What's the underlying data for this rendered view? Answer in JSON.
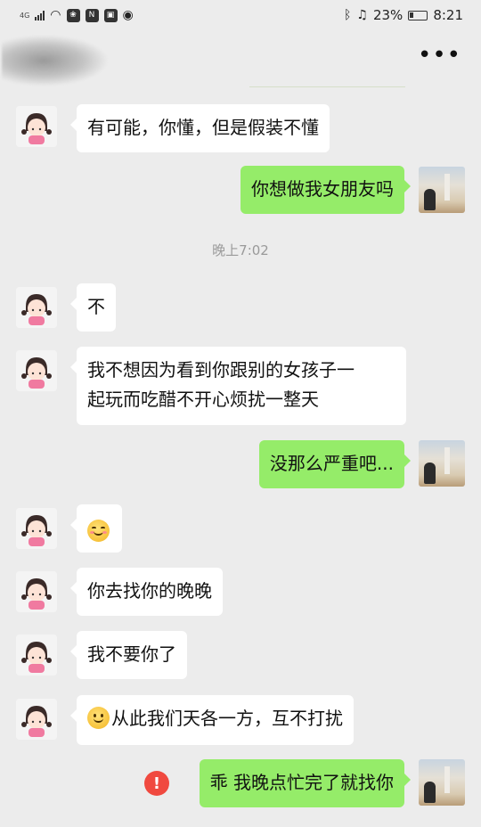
{
  "status_bar": {
    "network": "4G",
    "battery_percent": "23%",
    "time": "8:21"
  },
  "header": {
    "more_button_label": "•••"
  },
  "messages": [
    {
      "side": "left",
      "text": "有可能，你懂，但是假装不懂"
    },
    {
      "side": "right",
      "text": "你想做我女朋友吗"
    },
    {
      "type": "timestamp",
      "text": "晚上7:02"
    },
    {
      "side": "left",
      "text": "不"
    },
    {
      "side": "left",
      "line1": "我不想因为看到你跟别的女孩子一",
      "line2": "起玩而吃醋不开心烦扰一整天"
    },
    {
      "side": "right",
      "text": "没那么严重吧..."
    },
    {
      "side": "left",
      "emoji": "blushing-smile-emoji"
    },
    {
      "side": "left",
      "text": "你去找你的晚晚"
    },
    {
      "side": "left",
      "text": "我不要你了"
    },
    {
      "side": "left",
      "emoji": "slight-smile-emoji",
      "text": "从此我们天各一方，互不打扰"
    },
    {
      "side": "right",
      "text": "乖 我晚点忙完了就找你",
      "status": "send-failed",
      "status_icon": "!"
    }
  ],
  "colors": {
    "background": "#ececec",
    "sent_bubble": "#95ec69",
    "received_bubble": "#ffffff",
    "error": "#f0493f"
  }
}
